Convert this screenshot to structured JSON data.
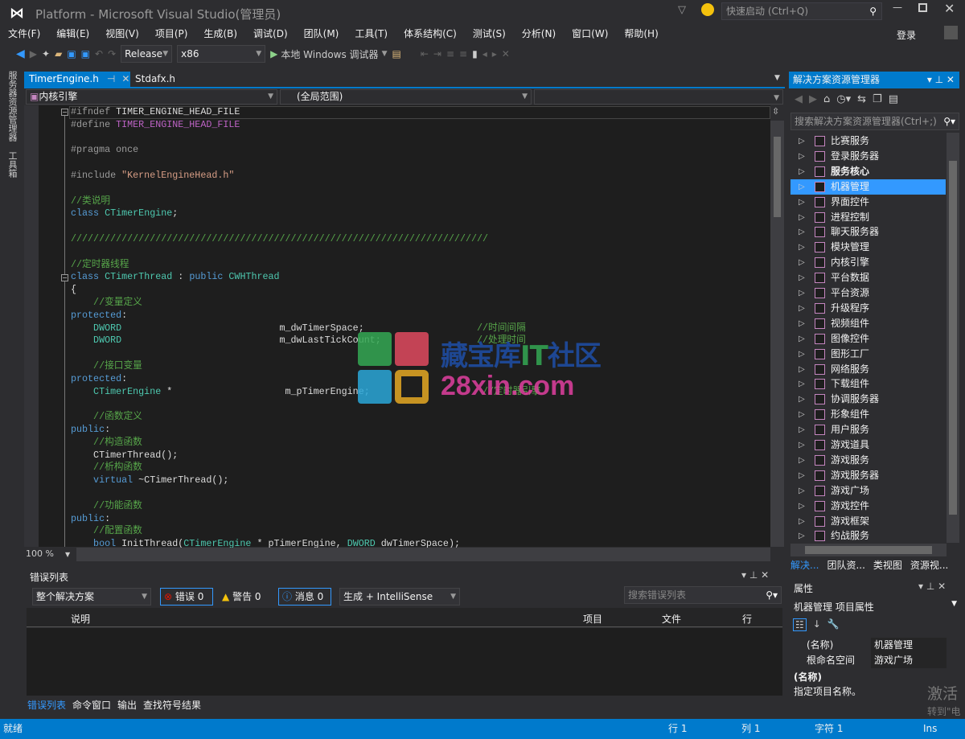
{
  "window": {
    "title": "Platform - Microsoft Visual Studio(管理员)",
    "quick_launch_placeholder": "快速启动 (Ctrl+Q)",
    "login": "登录",
    "window_buttons": [
      "minimize-icon",
      "maximize-icon",
      "close-icon"
    ]
  },
  "menu": [
    "文件(F)",
    "编辑(E)",
    "视图(V)",
    "项目(P)",
    "生成(B)",
    "调试(D)",
    "团队(M)",
    "工具(T)",
    "体系结构(C)",
    "测试(S)",
    "分析(N)",
    "窗口(W)",
    "帮助(H)"
  ],
  "toolbar": {
    "config": "Release",
    "platform": "x86",
    "debug_target": "本地 Windows 调试器"
  },
  "left_rail": [
    "服务器资源管理器",
    "工具箱"
  ],
  "editor": {
    "tabs": [
      {
        "label": "TimerEngine.h",
        "active": true
      },
      {
        "label": "Stdafx.h",
        "active": false
      }
    ],
    "nav_project": "内核引擎",
    "nav_scope": "(全局范围)",
    "zoom": "100 %",
    "lines": [
      [
        [
          "#ifndef ",
          "pp"
        ],
        [
          "TIMER_ENGINE_HEAD_FILE",
          "tx"
        ]
      ],
      [
        [
          "#define ",
          "pp"
        ],
        [
          "TIMER_ENGINE_HEAD_FILE",
          "mc"
        ]
      ],
      [],
      [
        [
          "#pragma once",
          "pp"
        ]
      ],
      [],
      [
        [
          "#include ",
          "pp"
        ],
        [
          "\"KernelEngineHead.h\"",
          "st"
        ]
      ],
      [],
      [
        [
          "//类说明",
          "cm"
        ]
      ],
      [
        [
          "class ",
          "kw"
        ],
        [
          "CTimerEngine",
          "ty"
        ],
        [
          ";",
          "tx"
        ]
      ],
      [],
      [
        [
          "//////////////////////////////////////////////////////////////////////////",
          "cm"
        ]
      ],
      [],
      [
        [
          "//定时器线程",
          "cm"
        ]
      ],
      [
        [
          "class ",
          "kw"
        ],
        [
          "CTimerThread",
          "ty"
        ],
        [
          " : ",
          "tx"
        ],
        [
          "public ",
          "kw"
        ],
        [
          "CWHThread",
          "ty"
        ]
      ],
      [
        [
          "{",
          "tx"
        ]
      ],
      [
        [
          "    //变量定义",
          "cm"
        ]
      ],
      [
        [
          "protected",
          "kw"
        ],
        [
          ":",
          "tx"
        ]
      ],
      [
        [
          "    DWORD",
          "ty"
        ],
        [
          "                            m_dwTimerSpace;",
          "tx"
        ],
        [
          "                    //时间间隔",
          "cm"
        ]
      ],
      [
        [
          "    DWORD",
          "ty"
        ],
        [
          "                            m_dwLastTickCount;",
          "tx"
        ],
        [
          "                 //处理时间",
          "cm"
        ]
      ],
      [],
      [
        [
          "    //接口变量",
          "cm"
        ]
      ],
      [
        [
          "protected",
          "kw"
        ],
        [
          ":",
          "tx"
        ]
      ],
      [
        [
          "    CTimerEngine",
          "ty"
        ],
        [
          " *                    m_pTimerEngine;",
          "tx"
        ],
        [
          "                    //定时器引擎",
          "cm"
        ]
      ],
      [],
      [
        [
          "    //函数定义",
          "cm"
        ]
      ],
      [
        [
          "public",
          "kw"
        ],
        [
          ":",
          "tx"
        ]
      ],
      [
        [
          "    //构造函数",
          "cm"
        ]
      ],
      [
        [
          "    CTimerThread();",
          "tx"
        ]
      ],
      [
        [
          "    //析构函数",
          "cm"
        ]
      ],
      [
        [
          "    virtual ",
          "kw"
        ],
        [
          "~CTimerThread();",
          "tx"
        ]
      ],
      [],
      [
        [
          "    //功能函数",
          "cm"
        ]
      ],
      [
        [
          "public",
          "kw"
        ],
        [
          ":",
          "tx"
        ]
      ],
      [
        [
          "    //配置函数",
          "cm"
        ]
      ],
      [
        [
          "    bool ",
          "kw"
        ],
        [
          "InitThread(",
          "tx"
        ],
        [
          "CTimerEngine",
          "ty"
        ],
        [
          " * pTimerEngine, ",
          "tx"
        ],
        [
          "DWORD",
          "ty"
        ],
        [
          " dwTimerSpace);",
          "tx"
        ]
      ]
    ]
  },
  "watermark": {
    "line1": "藏宝库IT社区",
    "line2": "28xin.com"
  },
  "solution_explorer": {
    "title": "解决方案资源管理器",
    "search_placeholder": "搜索解决方案资源管理器(Ctrl+;)",
    "items": [
      "比赛服务",
      "登录服务器",
      "服务核心",
      "机器管理",
      "界面控件",
      "进程控制",
      "聊天服务器",
      "模块管理",
      "内核引擎",
      "平台数据",
      "平台资源",
      "升级程序",
      "视频组件",
      "图像控件",
      "图形工厂",
      "网络服务",
      "下载组件",
      "协调服务器",
      "形象组件",
      "用户服务",
      "游戏道具",
      "游戏服务",
      "游戏服务器",
      "游戏广场",
      "游戏控件",
      "游戏框架",
      "约战服务"
    ],
    "selected": "机器管理",
    "bold": "服务核心",
    "tabs": [
      "解决...",
      "团队资...",
      "类视图",
      "资源视..."
    ]
  },
  "properties": {
    "title": "属性",
    "object": "机器管理  项目属性",
    "rows": [
      [
        "(名称)",
        "机器管理"
      ],
      [
        "根命名空间",
        "游戏广场"
      ]
    ],
    "desc_title": "(名称)",
    "desc_text": "指定项目名称。",
    "activate": "激活",
    "activate2": "转到\"电"
  },
  "error_list": {
    "title": "错误列表",
    "scope": "整个解决方案",
    "errors": "错误 0",
    "warnings": "警告 0",
    "messages": "消息 0",
    "source": "生成 + IntelliSense",
    "search_placeholder": "搜索错误列表",
    "columns": [
      "说明",
      "项目",
      "文件",
      "行"
    ],
    "bottom_tabs": [
      "错误列表",
      "命令窗口",
      "输出",
      "查找符号结果"
    ]
  },
  "status": {
    "ready": "就绪",
    "line": "行 1",
    "col": "列 1",
    "char": "字符 1",
    "mode": "Ins"
  },
  "colors": {
    "accent": "#007acc",
    "selection": "#3399ff",
    "background": "#2d2d30",
    "editor": "#1e1e1e"
  }
}
